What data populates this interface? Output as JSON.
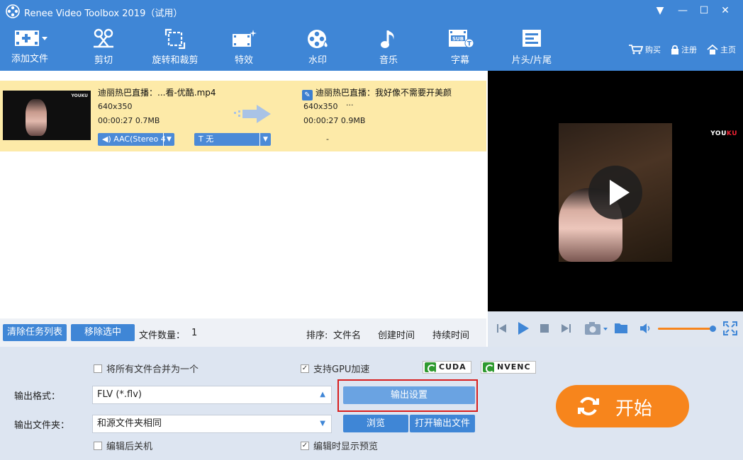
{
  "window": {
    "title": "Renee Video Toolbox 2019（试用）",
    "controls": {
      "menu": "▼",
      "minimize": "—",
      "maximize": "☐",
      "close": "✕"
    }
  },
  "toolbar": {
    "items": [
      {
        "label": "添加文件",
        "icon": "add-file-icon"
      },
      {
        "label": "剪切",
        "icon": "scissors-icon"
      },
      {
        "label": "旋转和裁剪",
        "icon": "rotate-crop-icon"
      },
      {
        "label": "特效",
        "icon": "effects-icon"
      },
      {
        "label": "水印",
        "icon": "watermark-icon"
      },
      {
        "label": "音乐",
        "icon": "music-icon"
      },
      {
        "label": "字幕",
        "icon": "subtitle-icon"
      },
      {
        "label": "片头/片尾",
        "icon": "intro-outro-icon"
      }
    ],
    "links": {
      "buy": "购买",
      "register": "注册",
      "home": "主页"
    }
  },
  "task": {
    "source": {
      "name": "迪丽热巴直播：...看-优酷.mp4",
      "resolution": "640x350",
      "duration_size": "00:00:27  0.7MB"
    },
    "output": {
      "name": "迪丽热巴直播：我好像不需要开美颜",
      "resolution": "640x350",
      "ellipsis": "···",
      "duration_size": "00:00:27  0.9MB"
    },
    "audio_track": "AAC(Stereo 4",
    "subtitle": "T  无",
    "dash": "-",
    "thumb_brand": "YOUKU"
  },
  "preview": {
    "brand_you": "YOU",
    "brand_ku": "KU"
  },
  "list_bar": {
    "clear_btn": "清除任务列表",
    "remove_btn": "移除选中",
    "file_count_label": "文件数量：",
    "file_count": "1",
    "sort_label": "排序:",
    "sort_name": "文件名",
    "sort_created": "创建时间",
    "sort_duration": "持续时间"
  },
  "settings": {
    "merge_label": "将所有文件合并为一个",
    "gpu_label": "支持GPU加速",
    "cuda": "CUDA",
    "nvenc": "NVENC",
    "format_label": "输出格式：",
    "format_value": "FLV (*.flv)",
    "output_settings_btn": "输出设置",
    "folder_label": "输出文件夹：",
    "folder_value": "和源文件夹相同",
    "browse_btn": "浏览",
    "open_output_btn": "打开输出文件",
    "shutdown_label": "编辑后关机",
    "preview_label": "编辑时显示预览",
    "start_btn": "开始"
  },
  "colors": {
    "accent": "#3f86d6",
    "task_bg": "#fdeaa8",
    "start": "#f7851c",
    "highlight": "#d81e1e"
  }
}
